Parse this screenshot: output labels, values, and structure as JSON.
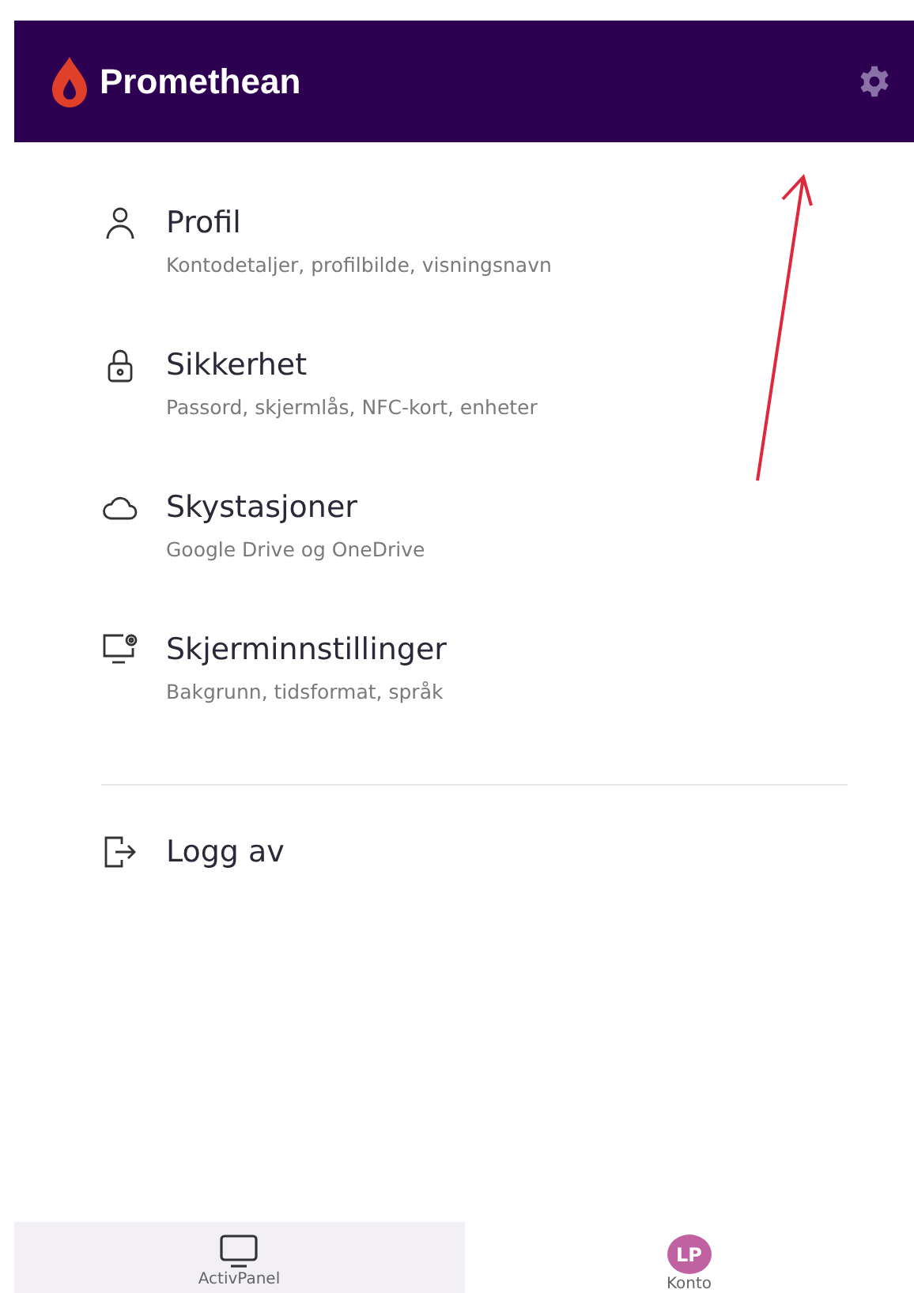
{
  "header": {
    "brand": "Promethean"
  },
  "menu": [
    {
      "title": "Profil",
      "subtitle": "Kontodetaljer, profilbilde, visningsnavn"
    },
    {
      "title": "Sikkerhet",
      "subtitle": "Passord, skjermlås, NFC-kort, enheter"
    },
    {
      "title": "Skystasjoner",
      "subtitle": "Google Drive og OneDrive"
    },
    {
      "title": "Skjerminnstillinger",
      "subtitle": "Bakgrunn, tidsformat, språk"
    }
  ],
  "logout": {
    "label": "Logg av"
  },
  "bottom_nav": [
    {
      "label": "ActivPanel",
      "selected": true,
      "kind": "icon"
    },
    {
      "label": "Konto",
      "selected": false,
      "kind": "avatar",
      "initials": "LP"
    }
  ]
}
